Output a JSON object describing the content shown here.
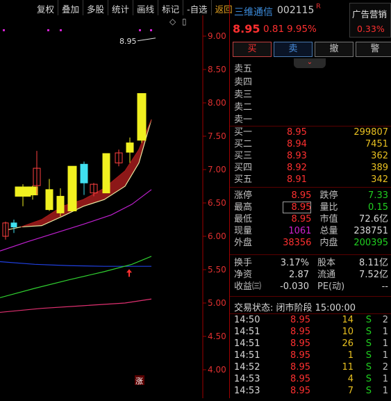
{
  "toolbar": {
    "items": [
      "复权",
      "叠加",
      "多股",
      "统计",
      "画线",
      "标记",
      "-自选",
      "返回"
    ]
  },
  "chart": {
    "y_ticks": [
      "9.00",
      "8.50",
      "8.00",
      "7.50",
      "7.00",
      "6.50",
      "6.00",
      "5.50",
      "5.00",
      "4.50",
      "4.00"
    ],
    "price_label": "8.95",
    "limit_up_marker": "涨",
    "top_icons": [
      "◇",
      "▯"
    ]
  },
  "chart_data": {
    "type": "candlestick",
    "y_range": [
      3.85,
      9.12
    ],
    "candles": [
      {
        "o": 6.0,
        "c": 6.2,
        "h": 6.22,
        "l": 5.95,
        "up": false
      },
      {
        "o": 6.2,
        "c": 6.14,
        "h": 6.25,
        "l": 6.05,
        "up": false
      },
      {
        "o": 6.6,
        "c": 6.74,
        "h": 6.78,
        "l": 6.45,
        "up": true
      },
      {
        "o": 6.62,
        "c": 6.74,
        "h": 6.76,
        "l": 6.55,
        "up": true
      },
      {
        "o": 6.76,
        "c": 7.02,
        "h": 7.28,
        "l": 6.62,
        "up": false
      },
      {
        "o": 6.4,
        "c": 6.7,
        "h": 6.86,
        "l": 6.38,
        "up": true
      },
      {
        "o": 6.35,
        "c": 6.6,
        "h": 6.72,
        "l": 6.3,
        "up": true
      },
      {
        "o": 6.38,
        "c": 7.05,
        "h": 7.05,
        "l": 6.38,
        "up": true
      },
      {
        "o": 7.08,
        "c": 6.8,
        "h": 7.12,
        "l": 6.62,
        "up": false
      },
      {
        "o": 6.65,
        "c": 6.78,
        "h": 6.8,
        "l": 6.6,
        "up": false
      },
      {
        "o": 6.65,
        "c": 7.24,
        "h": 7.24,
        "l": 6.65,
        "up": true
      },
      {
        "o": 7.1,
        "c": 7.25,
        "h": 7.3,
        "l": 7.05,
        "up": false
      },
      {
        "o": 7.26,
        "c": 7.4,
        "h": 7.48,
        "l": 7.1,
        "up": true
      },
      {
        "o": 7.44,
        "c": 8.14,
        "h": 8.14,
        "l": 7.4,
        "up": true
      }
    ],
    "lines": [
      {
        "name": "ma-yellow",
        "color": "#e8e8a0",
        "points": [
          [
            12,
            6.1
          ],
          [
            30,
            6.14
          ],
          [
            60,
            6.16
          ],
          [
            90,
            6.3
          ],
          [
            120,
            6.45
          ],
          [
            150,
            6.55
          ],
          [
            180,
            6.75
          ],
          [
            200,
            7.1
          ],
          [
            218,
            7.75
          ]
        ]
      },
      {
        "name": "ma-dark-red",
        "color": "#a01818",
        "points": [
          [
            30,
            6.14
          ],
          [
            60,
            6.25
          ],
          [
            90,
            6.45
          ],
          [
            120,
            6.55
          ],
          [
            150,
            6.72
          ],
          [
            180,
            6.98
          ],
          [
            200,
            7.3
          ],
          [
            218,
            7.75
          ]
        ]
      },
      {
        "name": "ma-magenta",
        "color": "#c020d0",
        "points": [
          [
            0,
            5.78
          ],
          [
            40,
            5.92
          ],
          [
            80,
            6.05
          ],
          [
            120,
            6.18
          ],
          [
            160,
            6.32
          ],
          [
            190,
            6.48
          ],
          [
            218,
            6.7
          ]
        ]
      },
      {
        "name": "ma-blue",
        "color": "#2040e0",
        "points": [
          [
            0,
            5.62
          ],
          [
            50,
            5.58
          ],
          [
            100,
            5.56
          ],
          [
            150,
            5.55
          ],
          [
            218,
            5.55
          ]
        ]
      },
      {
        "name": "ma-green",
        "color": "#30d030",
        "points": [
          [
            0,
            5.08
          ],
          [
            50,
            5.22
          ],
          [
            100,
            5.35
          ],
          [
            150,
            5.47
          ],
          [
            190,
            5.58
          ],
          [
            218,
            5.7
          ]
        ]
      },
      {
        "name": "ma-pink",
        "color": "#e03070",
        "points": [
          [
            0,
            4.86
          ],
          [
            60,
            4.92
          ],
          [
            120,
            4.96
          ],
          [
            180,
            5.0
          ],
          [
            218,
            5.06
          ]
        ]
      }
    ]
  },
  "stock": {
    "name": "三维通信",
    "code": "002115",
    "mark": "R",
    "price": "8.95",
    "change": "0.81",
    "change_pct": "9.95%"
  },
  "ad": {
    "label": "广告营销",
    "value": "0.33%"
  },
  "trade_buttons": [
    "买",
    "卖",
    "撤",
    "警"
  ],
  "collapse_icon": "⌄",
  "ask_labels": [
    "卖五",
    "卖四",
    "卖三",
    "卖二",
    "卖一"
  ],
  "bids": [
    {
      "label": "买一",
      "price": "8.95",
      "vol": "299807"
    },
    {
      "label": "买二",
      "price": "8.94",
      "vol": "7451"
    },
    {
      "label": "买三",
      "price": "8.93",
      "vol": "362"
    },
    {
      "label": "买四",
      "price": "8.92",
      "vol": "389"
    },
    {
      "label": "买五",
      "price": "8.91",
      "vol": "342"
    }
  ],
  "stats": [
    {
      "l1": "涨停",
      "v1": "8.95",
      "l2": "跌停",
      "v2": "7.33"
    },
    {
      "l1": "最高",
      "v1": "8.95",
      "l2": "量比",
      "v2": "0.15"
    },
    {
      "l1": "最低",
      "v1": "8.95",
      "l2": "市值",
      "v2": "72.6亿"
    },
    {
      "l1": "现量",
      "v1": "1061",
      "l2": "总量",
      "v2": "238751"
    },
    {
      "l1": "外盘",
      "v1": "38356",
      "l2": "内盘",
      "v2": "200395"
    }
  ],
  "stats2": [
    {
      "l1": "换手",
      "v1": "3.17%",
      "l2": "股本",
      "v2": "8.11亿"
    },
    {
      "l1": "净资",
      "v1": "2.87",
      "l2": "流通",
      "v2": "7.52亿"
    },
    {
      "l1": "收益㈢",
      "v1": "-0.030",
      "l2": "PE(动)",
      "v2": "--"
    }
  ],
  "trade_status": "交易状态: 闭市阶段 15:00:00",
  "ticks": [
    {
      "time": "14:50",
      "price": "8.95",
      "vol": "14",
      "side": "S",
      "n": "2"
    },
    {
      "time": "14:51",
      "price": "8.95",
      "vol": "10",
      "side": "S",
      "n": "1"
    },
    {
      "time": "14:51",
      "price": "8.95",
      "vol": "26",
      "side": "S",
      "n": "1"
    },
    {
      "time": "14:51",
      "price": "8.95",
      "vol": "1",
      "side": "S",
      "n": "1"
    },
    {
      "time": "14:52",
      "price": "8.95",
      "vol": "11",
      "side": "S",
      "n": "2"
    },
    {
      "time": "14:53",
      "price": "8.95",
      "vol": "4",
      "side": "S",
      "n": "1"
    },
    {
      "time": "14:53",
      "price": "8.95",
      "vol": "7",
      "side": "S",
      "n": "1"
    }
  ]
}
